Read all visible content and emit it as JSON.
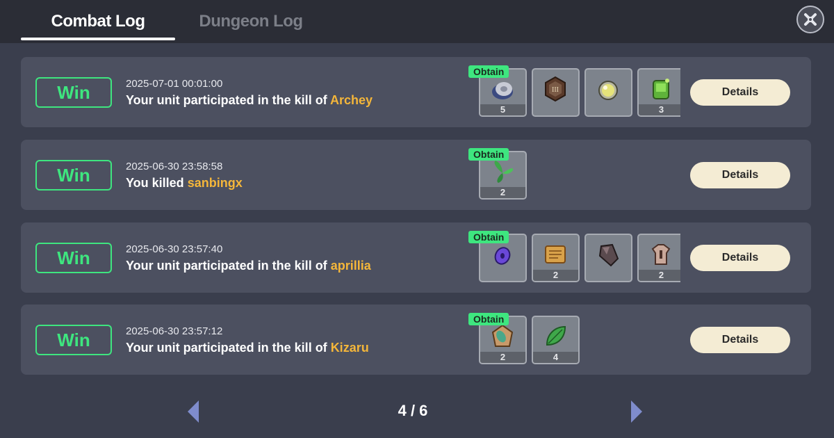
{
  "tabs": [
    {
      "label": "Combat Log",
      "active": true
    },
    {
      "label": "Dungeon Log",
      "active": false
    }
  ],
  "obtain_label": "Obtain",
  "details_label": "Details",
  "colors": {
    "win": "#3ee67f",
    "target_name": "#f4b63a",
    "obtain_tag": "#3ee67f"
  },
  "entries": [
    {
      "result": "Win",
      "timestamp": "2025-07-01 00:01:00",
      "message_prefix": "Your unit participated in the kill of ",
      "target": "Archey",
      "items": [
        {
          "icon": "cloth-bundle-icon",
          "qty": "5"
        },
        {
          "icon": "rune-medallion-icon",
          "qty": ""
        },
        {
          "icon": "pearl-orb-icon",
          "qty": ""
        },
        {
          "icon": "green-gem-icon",
          "qty": "3"
        }
      ]
    },
    {
      "result": "Win",
      "timestamp": "2025-06-30 23:58:58",
      "message_prefix": "You killed ",
      "target": "sanbingx",
      "items": [
        {
          "icon": "herb-sprout-icon",
          "qty": "2"
        }
      ]
    },
    {
      "result": "Win",
      "timestamp": "2025-06-30 23:57:40",
      "message_prefix": "Your unit participated in the kill of ",
      "target": "aprillia",
      "items": [
        {
          "icon": "purple-gem-icon",
          "qty": ""
        },
        {
          "icon": "scroll-icon",
          "qty": "2"
        },
        {
          "icon": "ore-chunk-icon",
          "qty": ""
        },
        {
          "icon": "leather-armor-icon",
          "qty": "2"
        }
      ]
    },
    {
      "result": "Win",
      "timestamp": "2025-06-30 23:57:12",
      "message_prefix": "Your unit participated in the kill of ",
      "target": "Kizaru",
      "items": [
        {
          "icon": "amber-ore-icon",
          "qty": "2"
        },
        {
          "icon": "green-leaf-icon",
          "qty": "4"
        }
      ]
    }
  ],
  "pagination": {
    "label": "4 / 6",
    "current": 4,
    "total": 6
  }
}
